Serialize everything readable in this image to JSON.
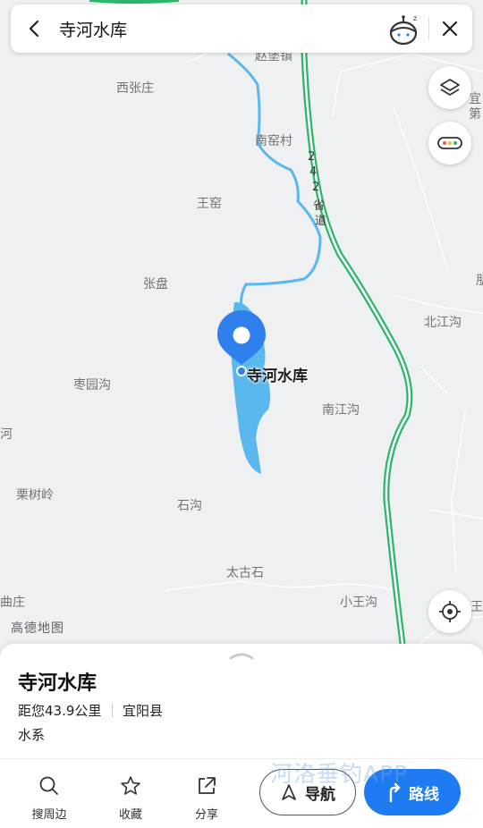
{
  "search": {
    "query": "寺河水库"
  },
  "map": {
    "places": [
      "赵堡镇",
      "西张庄",
      "南窑村",
      "王窑",
      "张盘",
      "北江沟",
      "枣园沟",
      "南江沟",
      "河",
      "栗树岭",
      "石沟",
      "太古石",
      "小王沟",
      "曲庄",
      "宜",
      "第",
      "朋",
      "王"
    ],
    "road_label": [
      "2",
      "4",
      "2",
      "省",
      "道"
    ],
    "poi_label": "寺河水库",
    "logo": "高德地图",
    "colors": {
      "highway": "#2db56b",
      "water": "#5ab8ef",
      "pin": "#2f80ed",
      "background": "#eef0f2"
    }
  },
  "poi": {
    "name": "寺河水库",
    "distance": "距您43.9公里",
    "county": "宜阳县",
    "category": "水系"
  },
  "actions": {
    "nearby": "搜周边",
    "favorite": "收藏",
    "share": "分享"
  },
  "buttons": {
    "navigate": "导航",
    "route": "路线"
  },
  "watermark": "河洛垂钓APP"
}
